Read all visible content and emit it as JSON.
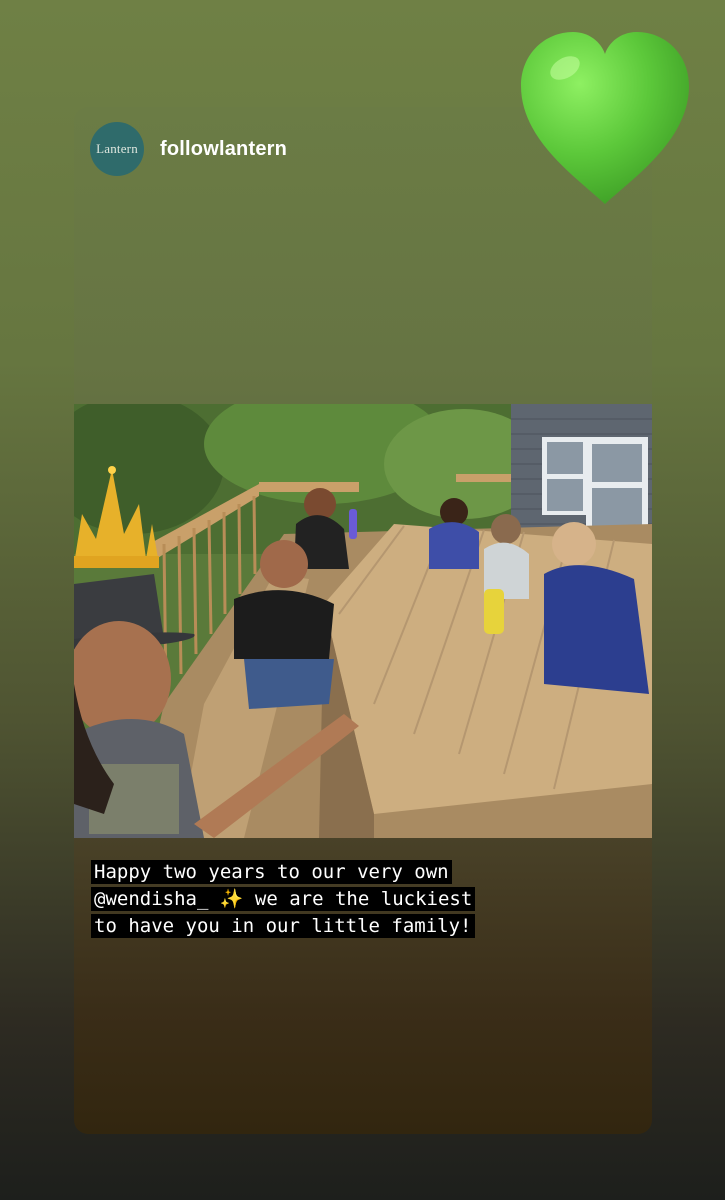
{
  "story": {
    "account": {
      "avatar_text": "Lantern",
      "username": "followlantern"
    },
    "caption_lines": [
      "Happy two years to our very own",
      "@wendisha_ ✨ we are the luckiest",
      "to have you in our little family!"
    ],
    "sticker": "green-heart-emoji",
    "photo_sticker": "crown-icon"
  },
  "colors": {
    "background_top": "#6f8045",
    "background_bottom": "#1d1f1c",
    "heart": "#5cc83a",
    "avatar": "#2f6b6b"
  }
}
